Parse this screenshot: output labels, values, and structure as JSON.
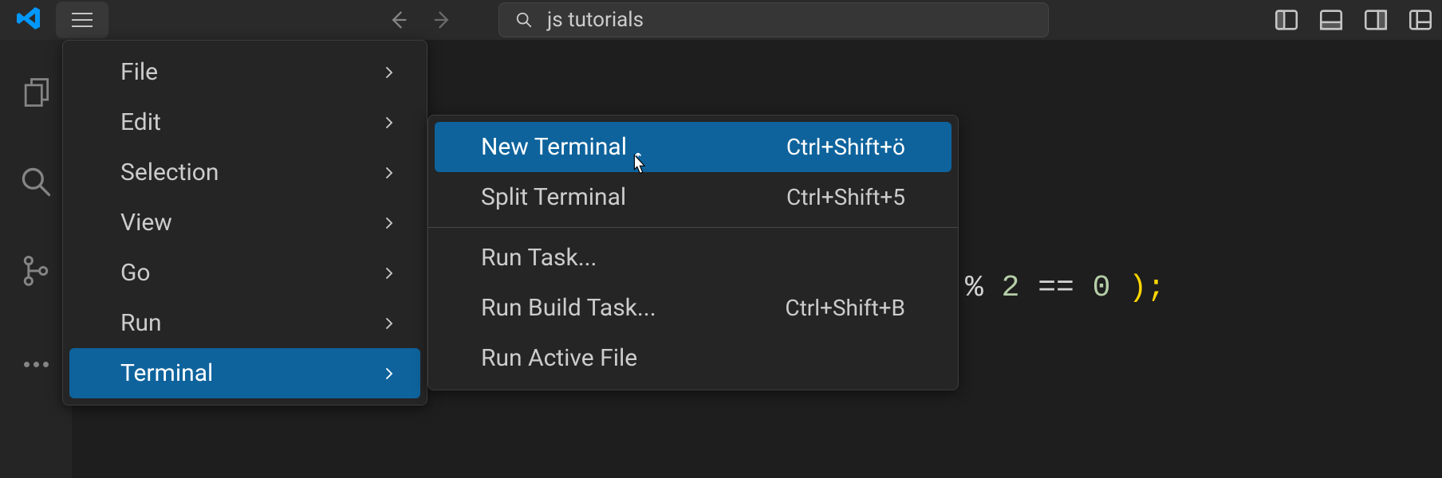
{
  "titlebar": {
    "search_text": "js tutorials"
  },
  "main_menu": {
    "items": [
      {
        "label": "File",
        "has_submenu": true
      },
      {
        "label": "Edit",
        "has_submenu": true
      },
      {
        "label": "Selection",
        "has_submenu": true
      },
      {
        "label": "View",
        "has_submenu": true
      },
      {
        "label": "Go",
        "has_submenu": true
      },
      {
        "label": "Run",
        "has_submenu": true
      },
      {
        "label": "Terminal",
        "has_submenu": true,
        "selected": true
      }
    ]
  },
  "submenu": {
    "groups": [
      [
        {
          "label": "New Terminal",
          "shortcut": "Ctrl+Shift+ö",
          "selected": true
        },
        {
          "label": "Split Terminal",
          "shortcut": "Ctrl+Shift+5"
        }
      ],
      [
        {
          "label": "Run Task..."
        },
        {
          "label": "Run Build Task...",
          "shortcut": "Ctrl+Shift+B"
        },
        {
          "label": "Run Active File"
        }
      ]
    ]
  },
  "editor": {
    "code_fragment": {
      "percent": "%",
      "number": "2",
      "operator": "==",
      "zero": "0",
      "close": ");"
    }
  }
}
